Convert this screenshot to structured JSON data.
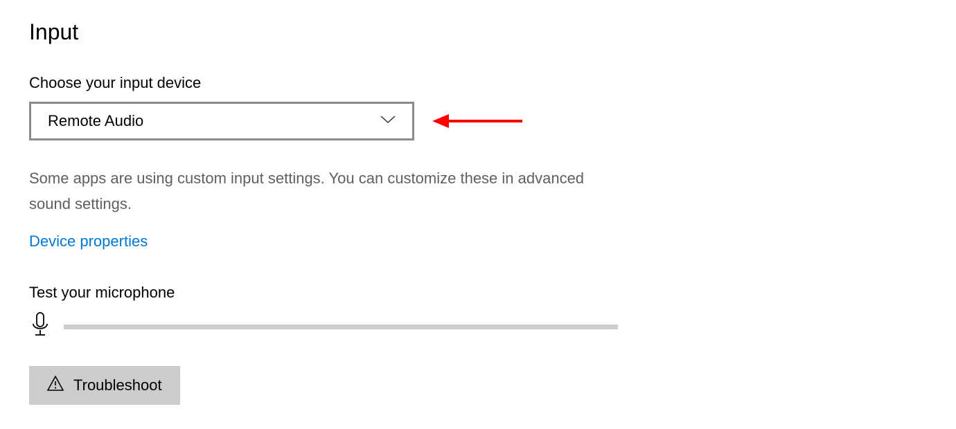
{
  "section": {
    "title": "Input",
    "choose_label": "Choose your input device",
    "dropdown_value": "Remote Audio",
    "info_text": "Some apps are using custom input settings. You can customize these in advanced sound settings.",
    "link_label": "Device properties",
    "test_label": "Test your microphone",
    "troubleshoot_label": "Troubleshoot"
  }
}
